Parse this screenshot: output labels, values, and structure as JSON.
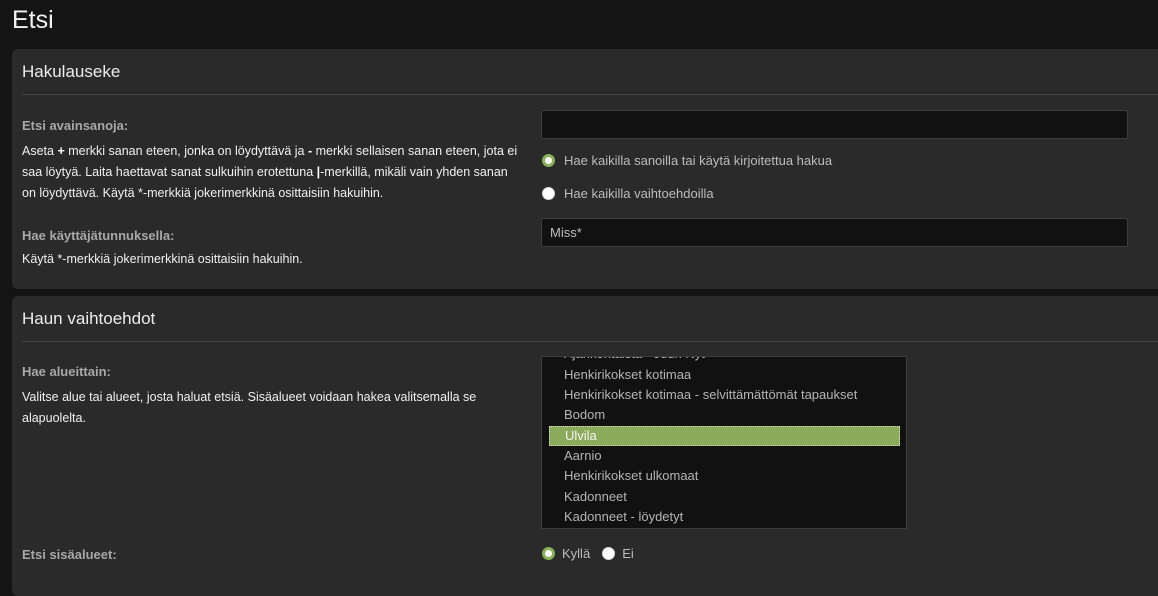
{
  "page": {
    "title": "Etsi"
  },
  "search_terms": {
    "title": "Hakulauseke",
    "keywords_label": "Etsi avainsanoja:",
    "keywords_help": {
      "p1": "Aseta ",
      "plus": "+",
      "p2": " merkki sanan eteen, jonka on löydyttävä ja ",
      "minus": "-",
      "p3": " merkki sellaisen sanan eteen, jota ei saa löytyä. Laita haettavat sanat sulkuihin erotettuna ",
      "pipe": "|",
      "p4": "-merkillä, mikäli vain yhden sanan on löydyttävä. Käytä *-merkkiä jokerimerkkinä osittaisiin hakuihin."
    },
    "keywords_value": "",
    "terms_options": [
      {
        "label": "Hae kaikilla sanoilla tai käytä kirjoitettua hakua",
        "checked": true
      },
      {
        "label": "Hae kaikilla vaihtoehdoilla",
        "checked": false
      }
    ],
    "author_label": "Hae käyttäjätunnuksella:",
    "author_help": "Käytä *-merkkiä jokerimerkkinä osittaisiin hakuihin.",
    "author_value": "Miss*"
  },
  "search_options": {
    "title": "Haun vaihtoehdot",
    "forums_label": "Hae alueittain:",
    "forums_help": "Valitse alue tai alueet, josta haluat etsiä. Sisäalueet voidaan hakea valitsemalla se alapuolelta.",
    "forums": [
      {
        "label": "Ajankohtaista - Juuri Nyt",
        "selected": false
      },
      {
        "label": "Henkirikokset kotimaa",
        "selected": false
      },
      {
        "label": "Henkirikokset kotimaa - selvittämättömät tapaukset",
        "selected": false
      },
      {
        "label": "Bodom",
        "selected": false
      },
      {
        "label": "Ulvila",
        "selected": true
      },
      {
        "label": "Aarnio",
        "selected": false
      },
      {
        "label": "Henkirikokset ulkomaat",
        "selected": false
      },
      {
        "label": "Kadonneet",
        "selected": false
      },
      {
        "label": "Kadonneet - löydetyt",
        "selected": false
      }
    ],
    "subforums_label": "Etsi sisäalueet:",
    "subforums_options": [
      {
        "label": "Kyllä",
        "checked": true
      },
      {
        "label": "Ei",
        "checked": false
      }
    ]
  }
}
